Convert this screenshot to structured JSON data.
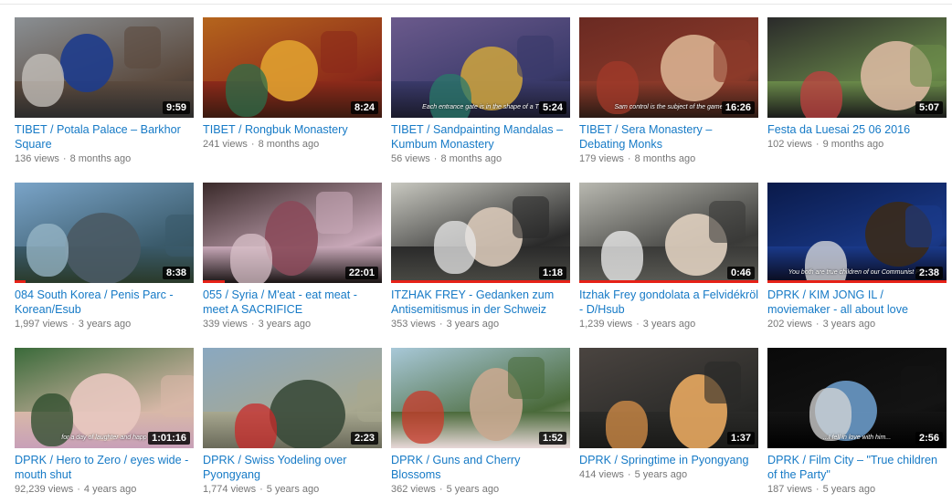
{
  "videos": [
    {
      "title": "TIBET / Potala Palace – Barkhor Square",
      "views": "136 views",
      "age": "8 months ago",
      "duration": "9:59",
      "caption": "",
      "colors": [
        "#8a8f93",
        "#5b4a3e",
        "#1e3c8c",
        "#c9c6c0",
        "#2b2b2b"
      ],
      "progress": 0
    },
    {
      "title": "TIBET / Rongbuk Monastery",
      "views": "241 views",
      "age": "8 months ago",
      "duration": "8:24",
      "caption": "",
      "colors": [
        "#b5651d",
        "#8c2a1a",
        "#e0a030",
        "#2c6e49",
        "#3a1a10"
      ],
      "progress": 0
    },
    {
      "title": "TIBET / Sandpainting Mandalas – Kumbum Monastery",
      "views": "56 views",
      "age": "8 months ago",
      "duration": "5:24",
      "caption": "Each entrance gate is in the shape of a T",
      "colors": [
        "#6b5a8c",
        "#3a3a6a",
        "#c8a040",
        "#2a7a6a",
        "#1a1a2a"
      ],
      "progress": 0
    },
    {
      "title": "TIBET / Sera Monastery – Debating Monks",
      "views": "179 views",
      "age": "8 months ago",
      "duration": "16:26",
      "caption": "Sam control is the subject of the game",
      "colors": [
        "#6a2a22",
        "#8c3a2a",
        "#d8b090",
        "#a23a2a",
        "#2a1a14"
      ],
      "progress": 0
    },
    {
      "title": "Festa da Luesai 25 06 2016",
      "views": "102 views",
      "age": "9 months ago",
      "duration": "5:07",
      "caption": "",
      "colors": [
        "#2a2a2a",
        "#6a8a4a",
        "#d8b8a0",
        "#c04040",
        "#1a1a1a"
      ],
      "progress": 0
    },
    {
      "title": "084 South Korea / Penis Parc - Korean/Esub",
      "views": "1,997 views",
      "age": "3 years ago",
      "duration": "8:38",
      "caption": "",
      "colors": [
        "#7aa4c8",
        "#3a5a6a",
        "#4a5a64",
        "#9ab8c8",
        "#2a3a2a"
      ],
      "progress": 0.06
    },
    {
      "title": "055 / Syria / M'eat - eat meat - meet A SACRIFICE",
      "views": "339 views",
      "age": "3 years ago",
      "duration": "22:01",
      "caption": "",
      "colors": [
        "#3a2a2a",
        "#c8a8b8",
        "#8a4a5a",
        "#d8c0c8",
        "#1a1414"
      ],
      "progress": 0.12
    },
    {
      "title": "ITZHAK FREY - Gedanken zum Antisemitismus in der Schweiz",
      "views": "353 views",
      "age": "3 years ago",
      "duration": "1:18",
      "caption": "",
      "colors": [
        "#c8c8c0",
        "#2a2a2a",
        "#d8c8b8",
        "#e8e8e8",
        "#4a4a44"
      ],
      "progress": 1.0
    },
    {
      "title": "Itzhak Frey gondolata a Felvidékröl - D/Hsub",
      "views": "1,239 views",
      "age": "3 years ago",
      "duration": "0:46",
      "caption": "",
      "colors": [
        "#b8b8b0",
        "#3a3a38",
        "#e0d0c0",
        "#f0f0f0",
        "#5a5a54"
      ],
      "progress": 1.0
    },
    {
      "title": "DPRK / KIM JONG IL / moviemaker - all about love",
      "views": "202 views",
      "age": "3 years ago",
      "duration": "2:38",
      "caption": "You both are true children of our Communist Par",
      "colors": [
        "#0a1a4a",
        "#1a3a8a",
        "#3a2a1a",
        "#e0e0e0",
        "#0a0a1a"
      ],
      "progress": 1.0
    },
    {
      "title": "DPRK / Hero to Zero / eyes wide - mouth shut",
      "views": "92,239 views",
      "age": "4 years ago",
      "duration": "1:01:16",
      "caption": "for a day of laughter and happ",
      "colors": [
        "#3a6a3a",
        "#d8b8a8",
        "#e8c8c0",
        "#2a4a2a",
        "#c8a0b8"
      ],
      "progress": 0
    },
    {
      "title": "DPRK / Swiss Yodeling over Pyongyang",
      "views": "1,774 views",
      "age": "5 years ago",
      "duration": "2:23",
      "caption": "",
      "colors": [
        "#8aa8c0",
        "#a8a890",
        "#3a4a3a",
        "#c82a2a",
        "#6a6a5a"
      ],
      "progress": 0
    },
    {
      "title": "DPRK / Guns and Cherry Blossoms",
      "views": "362 views",
      "age": "5 years ago",
      "duration": "1:52",
      "caption": "",
      "colors": [
        "#a8c8d8",
        "#4a6a3a",
        "#c8a890",
        "#c83a2a",
        "#e8d8d8"
      ],
      "progress": 0
    },
    {
      "title": "DPRK / Springtime in Pyongyang",
      "views": "414 views",
      "age": "5 years ago",
      "duration": "1:37",
      "caption": "",
      "colors": [
        "#4a4440",
        "#2a2a28",
        "#e8a860",
        "#d89048",
        "#1a1a18"
      ],
      "progress": 0
    },
    {
      "title": "DPRK / Film City – \"True children of the Party\"",
      "views": "187 views",
      "age": "5 years ago",
      "duration": "2:56",
      "caption": "...I fell in love with him...",
      "colors": [
        "#0a0a0a",
        "#141414",
        "#6a9ac8",
        "#d8d8d8",
        "#000000"
      ],
      "progress": 0
    }
  ]
}
